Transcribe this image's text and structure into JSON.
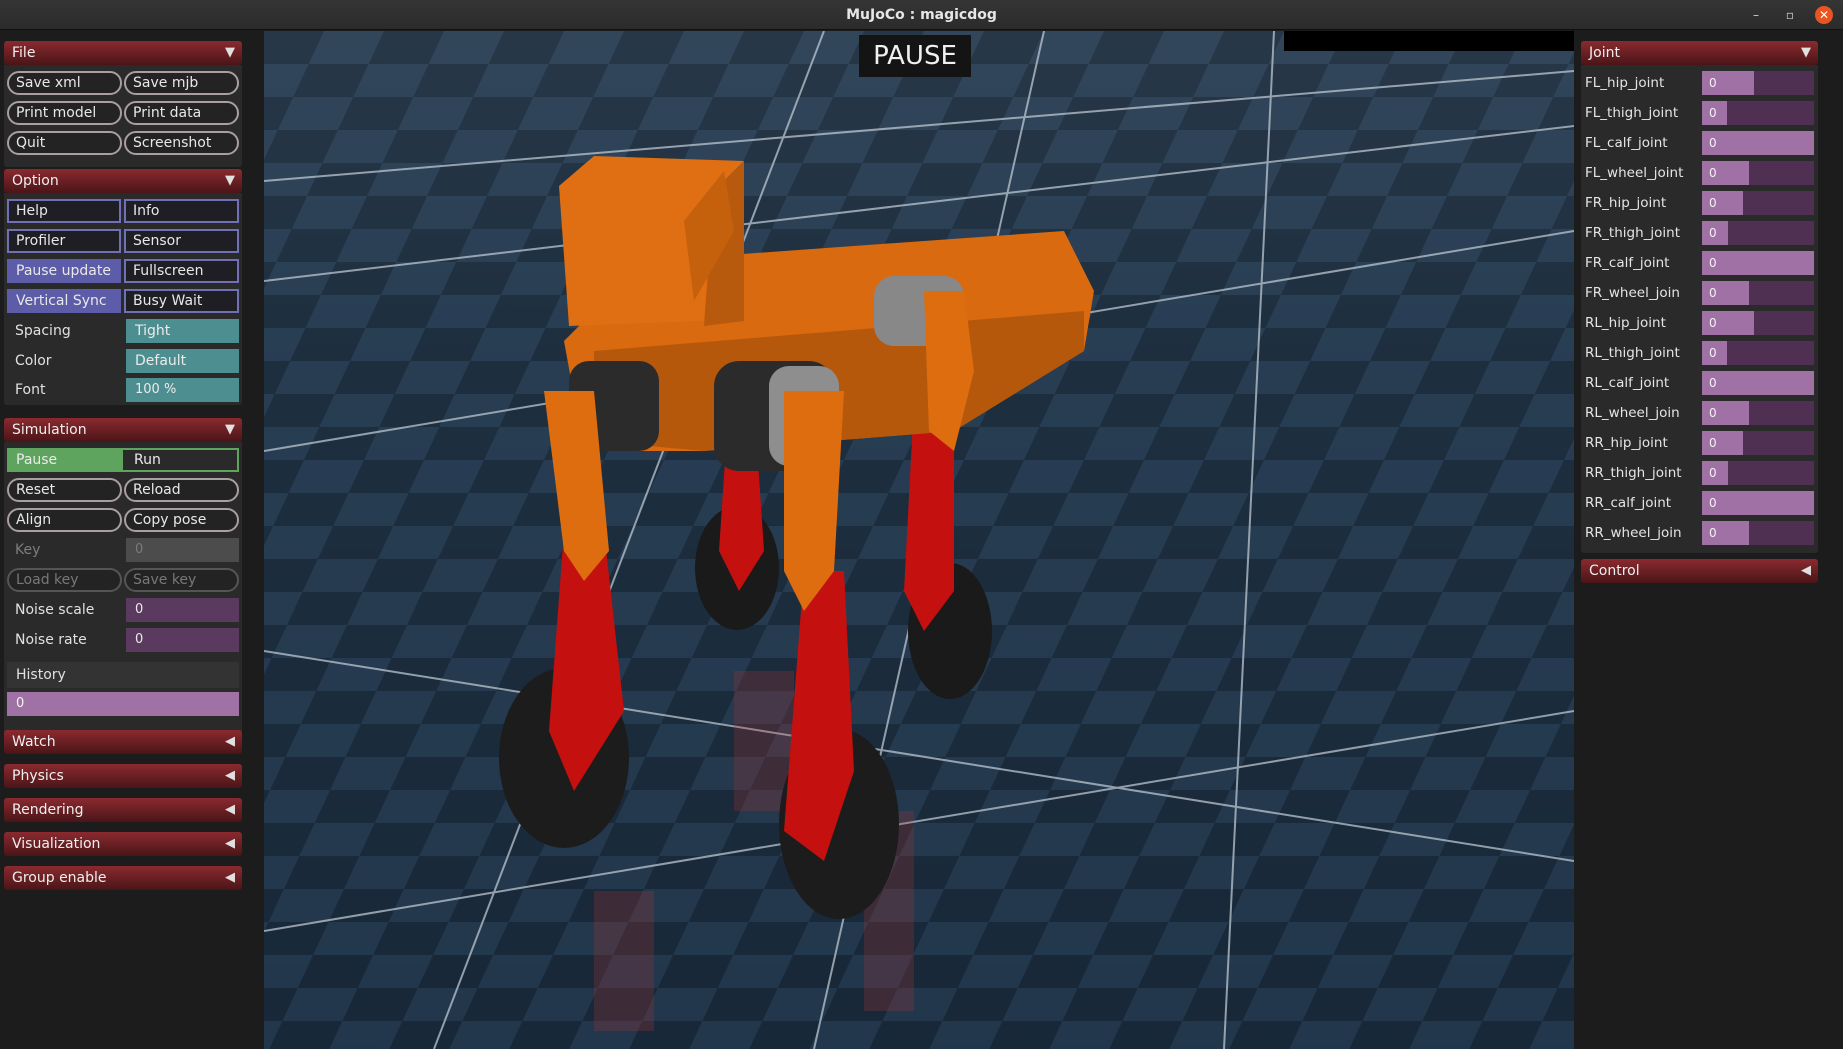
{
  "window": {
    "title": "MuJoCo : magicdog",
    "minimize_glyph": "–",
    "restore_glyph": "▫",
    "close_glyph": "✕"
  },
  "viewport": {
    "status": "PAUSE"
  },
  "left": {
    "file": {
      "header": "File",
      "buttons": [
        "Save xml",
        "Save mjb",
        "Print model",
        "Print data",
        "Quit",
        "Screenshot"
      ]
    },
    "option": {
      "header": "Option",
      "toggles": [
        {
          "label": "Help",
          "on": false
        },
        {
          "label": "Info",
          "on": false
        },
        {
          "label": "Profiler",
          "on": false
        },
        {
          "label": "Sensor",
          "on": false
        },
        {
          "label": "Pause update",
          "on": true
        },
        {
          "label": "Fullscreen",
          "on": false
        },
        {
          "label": "Vertical Sync",
          "on": true
        },
        {
          "label": "Busy Wait",
          "on": false
        }
      ],
      "spacing_label": "Spacing",
      "spacing_value": "Tight",
      "color_label": "Color",
      "color_value": "Default",
      "font_label": "Font",
      "font_value": "100 %"
    },
    "simulation": {
      "header": "Simulation",
      "pause": "Pause",
      "run": "Run",
      "reset": "Reset",
      "reload": "Reload",
      "align": "Align",
      "copy_pose": "Copy pose",
      "key_label": "Key",
      "key_value": "0",
      "load_key": "Load key",
      "save_key": "Save key",
      "noise_scale_label": "Noise scale",
      "noise_scale_value": "0",
      "noise_rate_label": "Noise rate",
      "noise_rate_value": "0",
      "history_label": "History",
      "history_value": "0"
    },
    "collapsed": [
      "Watch",
      "Physics",
      "Rendering",
      "Visualization",
      "Group enable"
    ]
  },
  "right": {
    "joint_header": "Joint",
    "joints": [
      {
        "name": "FL_hip_joint",
        "value": "0",
        "fill": 0.46
      },
      {
        "name": "FL_thigh_joint",
        "value": "0",
        "fill": 0.22
      },
      {
        "name": "FL_calf_joint",
        "value": "0",
        "fill": 1.0
      },
      {
        "name": "FL_wheel_joint",
        "value": "0",
        "fill": 0.42
      },
      {
        "name": "FR_hip_joint",
        "value": "0",
        "fill": 0.37
      },
      {
        "name": "FR_thigh_joint",
        "value": "0",
        "fill": 0.23
      },
      {
        "name": "FR_calf_joint",
        "value": "0",
        "fill": 1.0
      },
      {
        "name": "FR_wheel_join",
        "value": "0",
        "fill": 0.42
      },
      {
        "name": "RL_hip_joint",
        "value": "0",
        "fill": 0.46
      },
      {
        "name": "RL_thigh_joint",
        "value": "0",
        "fill": 0.22
      },
      {
        "name": "RL_calf_joint",
        "value": "0",
        "fill": 1.0
      },
      {
        "name": "RL_wheel_join",
        "value": "0",
        "fill": 0.42
      },
      {
        "name": "RR_hip_joint",
        "value": "0",
        "fill": 0.37
      },
      {
        "name": "RR_thigh_joint",
        "value": "0",
        "fill": 0.23
      },
      {
        "name": "RR_calf_joint",
        "value": "0",
        "fill": 1.0
      },
      {
        "name": "RR_wheel_join",
        "value": "0",
        "fill": 0.42
      }
    ],
    "control_header": "Control"
  }
}
